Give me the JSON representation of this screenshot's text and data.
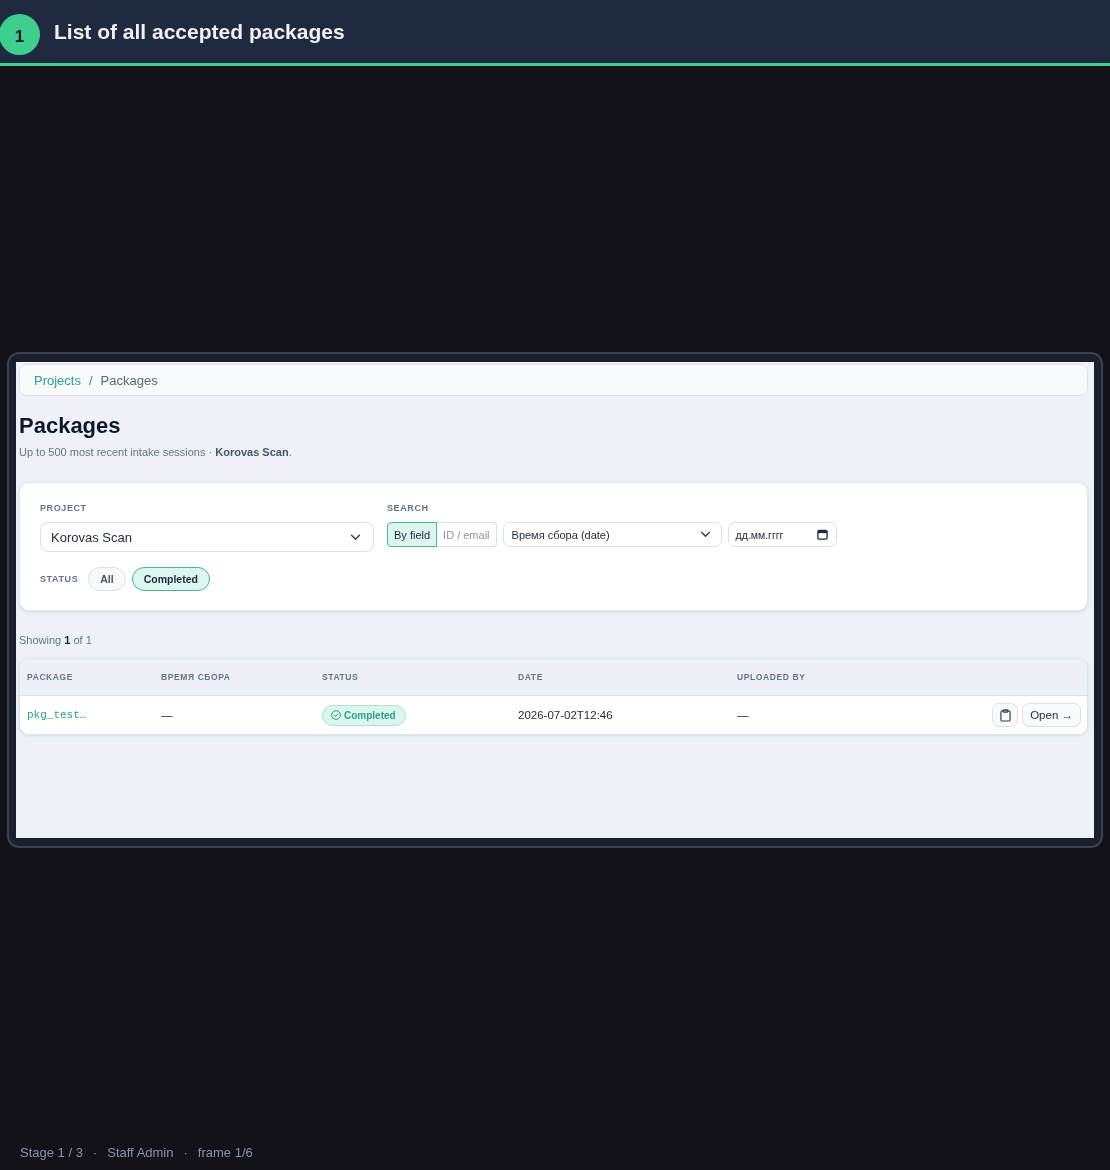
{
  "banner": {
    "step": "1",
    "title": "List of all accepted packages"
  },
  "breadcrumb": {
    "items": [
      "Projects",
      "Packages"
    ],
    "separator": "/"
  },
  "page": {
    "title": "Packages",
    "subtitle": "Up to 500 most recent intake sessions · **Korovas Scan**."
  },
  "filters": {
    "project": {
      "label": "PROJECT",
      "value": "Korovas Scan"
    },
    "search": {
      "label": "SEARCH",
      "modes": [
        {
          "label": "By field",
          "selected": true
        },
        {
          "label": "ID / email",
          "selected": false
        }
      ],
      "field": "Время сбора (date)",
      "date": {
        "placeholder": "дд.мм.гггг"
      }
    },
    "status": {
      "label": "STATUS",
      "options": [
        {
          "label": "All",
          "selected": false
        },
        {
          "label": "Completed",
          "selected": true
        }
      ]
    }
  },
  "results": {
    "summary": "Showing **1** of 1"
  },
  "table": {
    "columns": [
      "PACKAGE",
      "ВРЕМЯ СБОРА",
      "STATUS",
      "DATE",
      "UPLOADED BY"
    ],
    "rows": [
      {
        "package": "pkg_test…",
        "collection_time": "—",
        "status": "Completed",
        "date": "2026-07-02T12:46",
        "uploaded_by": "—",
        "action": "Open →"
      }
    ]
  },
  "footer": [
    "Stage 1 / 3",
    "·",
    "Staff Admin",
    "·",
    "frame 1/6"
  ]
}
